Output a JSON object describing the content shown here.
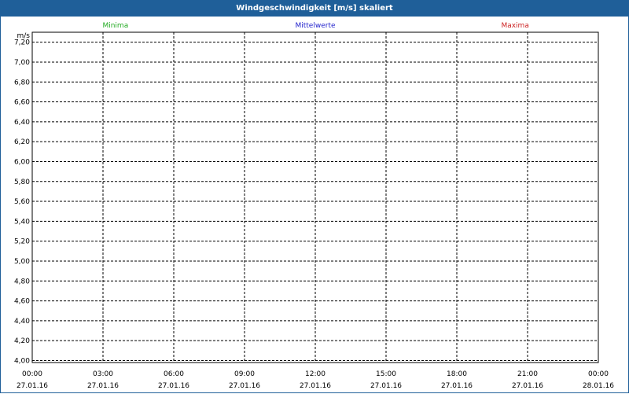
{
  "window": {
    "title": "Windgeschwindigkeit [m/s] skaliert"
  },
  "chart_data": {
    "type": "line",
    "title": "Windgeschwindigkeit [m/s] skaliert",
    "ylabel": "m/s",
    "xlabel": "",
    "ylim": [
      3.98,
      7.3
    ],
    "yticks": [
      {
        "value": 4.0,
        "label": "4,00"
      },
      {
        "value": 4.2,
        "label": "4,20"
      },
      {
        "value": 4.4,
        "label": "4,40"
      },
      {
        "value": 4.6,
        "label": "4,60"
      },
      {
        "value": 4.8,
        "label": "4,80"
      },
      {
        "value": 5.0,
        "label": "5,00"
      },
      {
        "value": 5.2,
        "label": "5,20"
      },
      {
        "value": 5.4,
        "label": "5,40"
      },
      {
        "value": 5.6,
        "label": "5,60"
      },
      {
        "value": 5.8,
        "label": "5,80"
      },
      {
        "value": 6.0,
        "label": "6,00"
      },
      {
        "value": 6.2,
        "label": "6,20"
      },
      {
        "value": 6.4,
        "label": "6,40"
      },
      {
        "value": 6.6,
        "label": "6,60"
      },
      {
        "value": 6.8,
        "label": "6,80"
      },
      {
        "value": 7.0,
        "label": "7,00"
      },
      {
        "value": 7.2,
        "label": "7,20"
      }
    ],
    "xticks": [
      {
        "time": "00:00",
        "date": "27.01.16"
      },
      {
        "time": "03:00",
        "date": "27.01.16"
      },
      {
        "time": "06:00",
        "date": "27.01.16"
      },
      {
        "time": "09:00",
        "date": "27.01.16"
      },
      {
        "time": "12:00",
        "date": "27.01.16"
      },
      {
        "time": "15:00",
        "date": "27.01.16"
      },
      {
        "time": "18:00",
        "date": "27.01.16"
      },
      {
        "time": "21:00",
        "date": "27.01.16"
      },
      {
        "time": "00:00",
        "date": "28.01.16"
      }
    ],
    "grid": true,
    "legend_placement": "top",
    "series": [
      {
        "name": "Minima",
        "color": "#22aa22",
        "values": []
      },
      {
        "name": "Mittelwerte",
        "color": "#2222cc",
        "values": []
      },
      {
        "name": "Maxima",
        "color": "#cc2222",
        "values": []
      }
    ]
  }
}
